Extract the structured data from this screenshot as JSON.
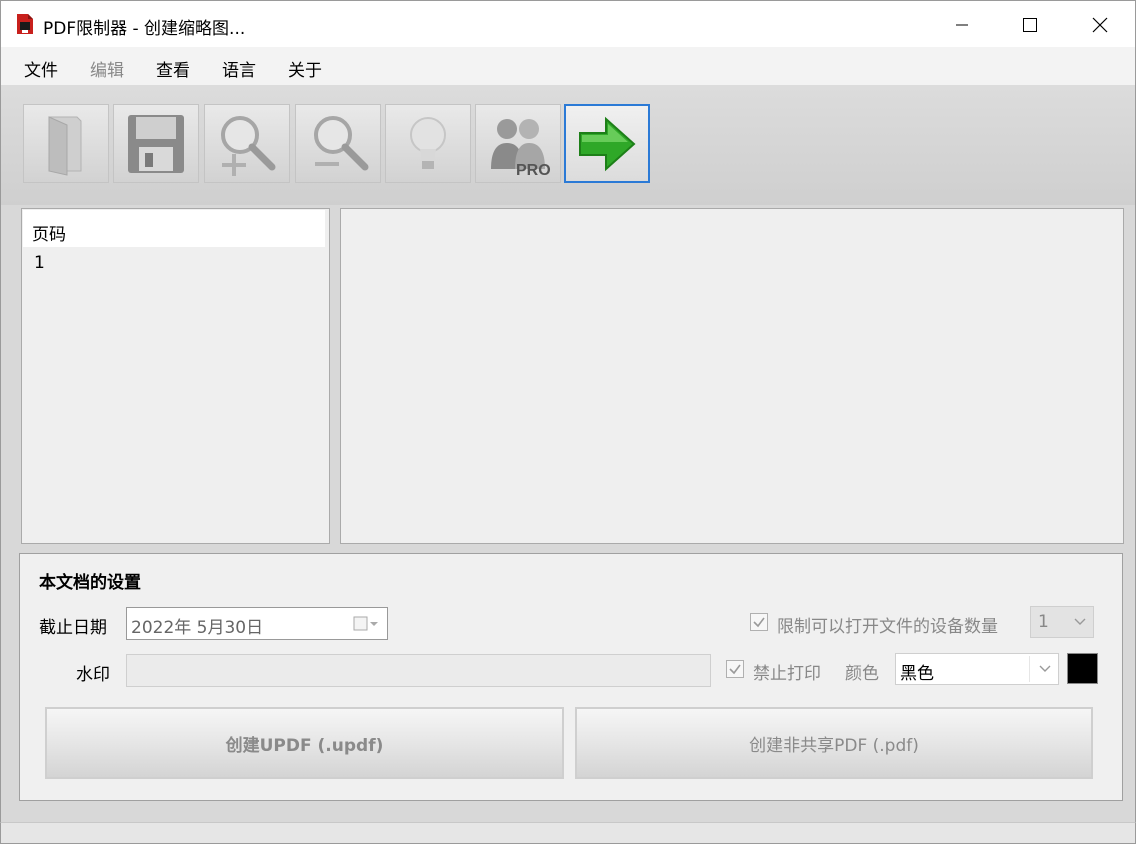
{
  "window": {
    "title": "PDF限制器 - 创建缩略图..."
  },
  "menu": [
    {
      "label": "文件",
      "disabled": false
    },
    {
      "label": "编辑",
      "disabled": true
    },
    {
      "label": "查看",
      "disabled": false
    },
    {
      "label": "语言",
      "disabled": false
    },
    {
      "label": "关于",
      "disabled": false
    }
  ],
  "toolbar": {
    "buttons": [
      {
        "icon": "open-file-icon"
      },
      {
        "icon": "save-floppy-icon"
      },
      {
        "icon": "zoom-in-icon"
      },
      {
        "icon": "zoom-out-icon"
      },
      {
        "icon": "lightbulb-icon"
      },
      {
        "icon": "pro-users-icon",
        "badge": "PRO"
      },
      {
        "icon": "green-arrow-right-icon"
      }
    ]
  },
  "page_list": {
    "header": "页码",
    "rows": [
      "1"
    ]
  },
  "settings": {
    "title": "本文档的设置",
    "expiry_label": "截止日期",
    "expiry_value": "2022年  5月30日",
    "watermark_label": "水印",
    "watermark_value": "",
    "limit_devices_label": "限制可以打开文件的设备数量",
    "limit_devices_checked": true,
    "device_count": "1",
    "no_print_label": "禁止打印",
    "no_print_checked": true,
    "color_label": "颜色",
    "color_value": "黑色",
    "color_swatch": "#000000"
  },
  "buttons": {
    "create_updf": "创建UPDF (.updf)",
    "create_pdf": "创建非共享PDF (.pdf)"
  }
}
